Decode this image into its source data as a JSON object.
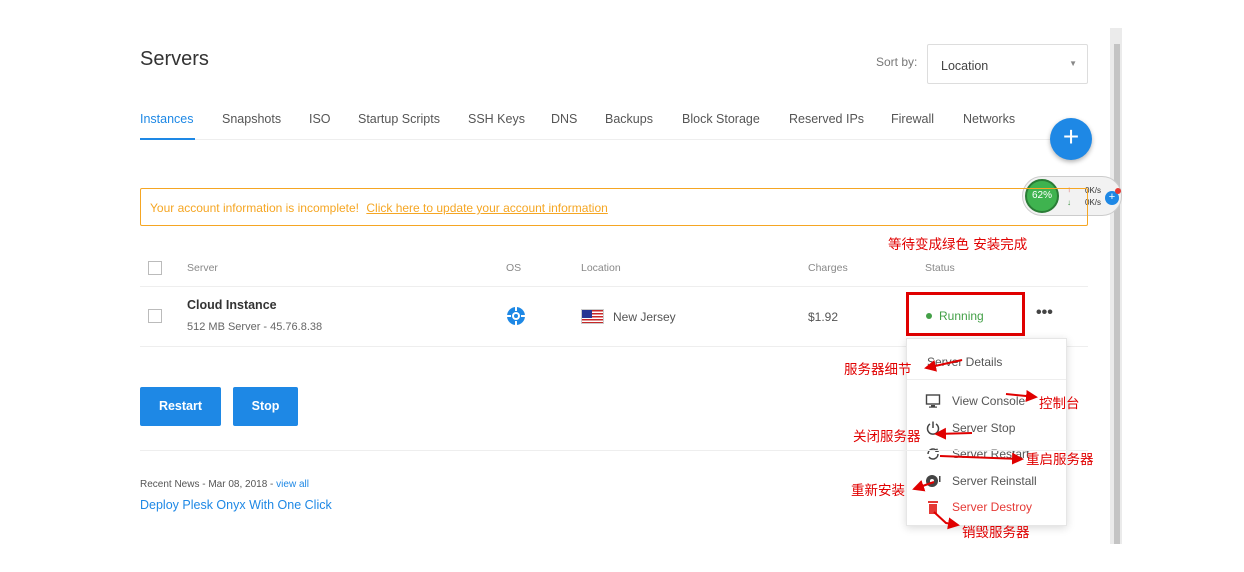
{
  "page": {
    "title": "Servers"
  },
  "sort": {
    "label": "Sort by:",
    "value": "Location"
  },
  "tabs": [
    "Instances",
    "Snapshots",
    "ISO",
    "Startup Scripts",
    "SSH Keys",
    "DNS",
    "Backups",
    "Block Storage",
    "Reserved IPs",
    "Firewall",
    "Networks"
  ],
  "fab": {
    "label": "+"
  },
  "speed_widget": {
    "percent": "62%",
    "up": "0K/s",
    "down": "0K/s"
  },
  "alert": {
    "text": "Your account information is incomplete!",
    "link": "Click here to update your account information"
  },
  "annotations": {
    "wait_green": "等待变成绿色 安装完成",
    "details": "服务器细节",
    "console": "控制台",
    "stop": "关闭服务器",
    "restart": "重启服务器",
    "reinstall": "重新安装",
    "destroy": "销毁服务器"
  },
  "table": {
    "headers": {
      "server": "Server",
      "os": "OS",
      "location": "Location",
      "charges": "Charges",
      "status": "Status"
    },
    "rows": [
      {
        "name": "Cloud Instance",
        "sub": "512 MB Server - 45.76.8.38",
        "location": "New Jersey",
        "charges": "$1.92",
        "status": "Running"
      }
    ]
  },
  "row_menu": {
    "more": "•••",
    "details": "Server Details",
    "console": "View Console",
    "stop": "Server Stop",
    "restart": "Server Restart",
    "reinstall": "Server Reinstall",
    "destroy": "Server Destroy"
  },
  "buttons": {
    "restart": "Restart",
    "stop": "Stop"
  },
  "news": {
    "meta": "Recent News - Mar 08, 2018 -",
    "view_all": "view all",
    "title": "Deploy Plesk Onyx With One Click"
  },
  "colors": {
    "accent": "#1e88e5",
    "warning": "#f5a623",
    "running": "#43a047",
    "danger": "#e53935",
    "annotation": "#e00000"
  },
  "icons": [
    "plus-icon",
    "os-icon",
    "us-flag-icon",
    "monitor-icon",
    "power-icon",
    "refresh-icon",
    "reinstall-icon",
    "trash-icon",
    "caret-down-icon",
    "more-icon"
  ]
}
